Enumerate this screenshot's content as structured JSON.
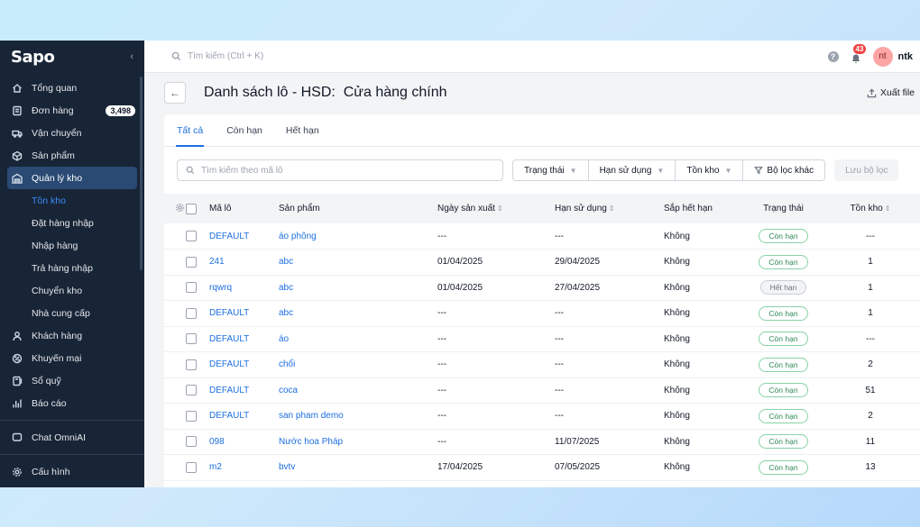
{
  "app": {
    "logo": "Sapo",
    "collapse": "‹"
  },
  "sidebar": {
    "items": [
      {
        "label": "Tổng quan",
        "icon": "home-icon"
      },
      {
        "label": "Đơn hàng",
        "icon": "order-icon",
        "badge": "3,498"
      },
      {
        "label": "Vận chuyển",
        "icon": "truck-icon"
      },
      {
        "label": "Sản phẩm",
        "icon": "box-icon"
      },
      {
        "label": "Quản lý kho",
        "icon": "warehouse-icon",
        "active": true
      }
    ],
    "subitems": [
      {
        "label": "Tồn kho",
        "active": true
      },
      {
        "label": "Đặt hàng nhập"
      },
      {
        "label": "Nhập hàng"
      },
      {
        "label": "Trả hàng nhập"
      },
      {
        "label": "Chuyển kho"
      },
      {
        "label": "Nhà cung cấp"
      }
    ],
    "items2": [
      {
        "label": "Khách hàng",
        "icon": "user-icon"
      },
      {
        "label": "Khuyến mại",
        "icon": "promo-icon"
      },
      {
        "label": "Sổ quỹ",
        "icon": "cashbook-icon"
      },
      {
        "label": "Báo cáo",
        "icon": "report-icon"
      }
    ],
    "chat": {
      "label": "Chat OmniAI",
      "icon": "chat-icon"
    },
    "config": {
      "label": "Cấu hình",
      "icon": "gear-icon"
    }
  },
  "topbar": {
    "search_placeholder": "Tìm kiếm (Ctrl + K)",
    "help": "?",
    "notif_count": "43",
    "avatar": "nt",
    "username": "ntk"
  },
  "page": {
    "title": "Danh sách lô - HSD:",
    "store": "Cửa hàng chính",
    "export_label": "Xuất file"
  },
  "tabs": [
    "Tất cả",
    "Còn hạn",
    "Hết hạn"
  ],
  "filters": {
    "search_placeholder": "Tìm kiếm theo mã lô",
    "status": "Trạng thái",
    "expiry": "Hạn sử dụng",
    "stock": "Tồn kho",
    "more": "Bộ lọc khác",
    "save": "Lưu bộ lọc"
  },
  "table": {
    "headers": {
      "lot": "Mã lô",
      "product": "Sản phẩm",
      "mfg": "Ngày sản xuất",
      "exp": "Hạn sử dụng",
      "soon": "Sắp hết hạn",
      "status": "Trạng thái",
      "stock": "Tồn kho"
    },
    "rows": [
      {
        "lot": "DEFAULT",
        "product": "áo phông",
        "mfg": "---",
        "exp": "---",
        "soon": "Không",
        "status": "Còn hạn",
        "expired": false,
        "stock": "---"
      },
      {
        "lot": "241",
        "product": "abc",
        "mfg": "01/04/2025",
        "exp": "29/04/2025",
        "soon": "Không",
        "status": "Còn hạn",
        "expired": false,
        "stock": "1"
      },
      {
        "lot": "rqwrq",
        "product": "abc",
        "mfg": "01/04/2025",
        "exp": "27/04/2025",
        "soon": "Không",
        "status": "Hết hạn",
        "expired": true,
        "stock": "1"
      },
      {
        "lot": "DEFAULT",
        "product": "abc",
        "mfg": "---",
        "exp": "---",
        "soon": "Không",
        "status": "Còn hạn",
        "expired": false,
        "stock": "1"
      },
      {
        "lot": "DEFAULT",
        "product": "áo",
        "mfg": "---",
        "exp": "---",
        "soon": "Không",
        "status": "Còn hạn",
        "expired": false,
        "stock": "---"
      },
      {
        "lot": "DEFAULT",
        "product": "chổi",
        "mfg": "---",
        "exp": "---",
        "soon": "Không",
        "status": "Còn hạn",
        "expired": false,
        "stock": "2"
      },
      {
        "lot": "DEFAULT",
        "product": "coca",
        "mfg": "---",
        "exp": "---",
        "soon": "Không",
        "status": "Còn hạn",
        "expired": false,
        "stock": "51"
      },
      {
        "lot": "DEFAULT",
        "product": "san pham demo",
        "mfg": "---",
        "exp": "---",
        "soon": "Không",
        "status": "Còn hạn",
        "expired": false,
        "stock": "2"
      },
      {
        "lot": "098",
        "product": "Nước hoa Pháp",
        "mfg": "---",
        "exp": "11/07/2025",
        "soon": "Không",
        "status": "Còn hạn",
        "expired": false,
        "stock": "11"
      },
      {
        "lot": "m2",
        "product": "bvtv",
        "mfg": "17/04/2025",
        "exp": "07/05/2025",
        "soon": "Không",
        "status": "Còn hạn",
        "expired": false,
        "stock": "13"
      }
    ]
  }
}
